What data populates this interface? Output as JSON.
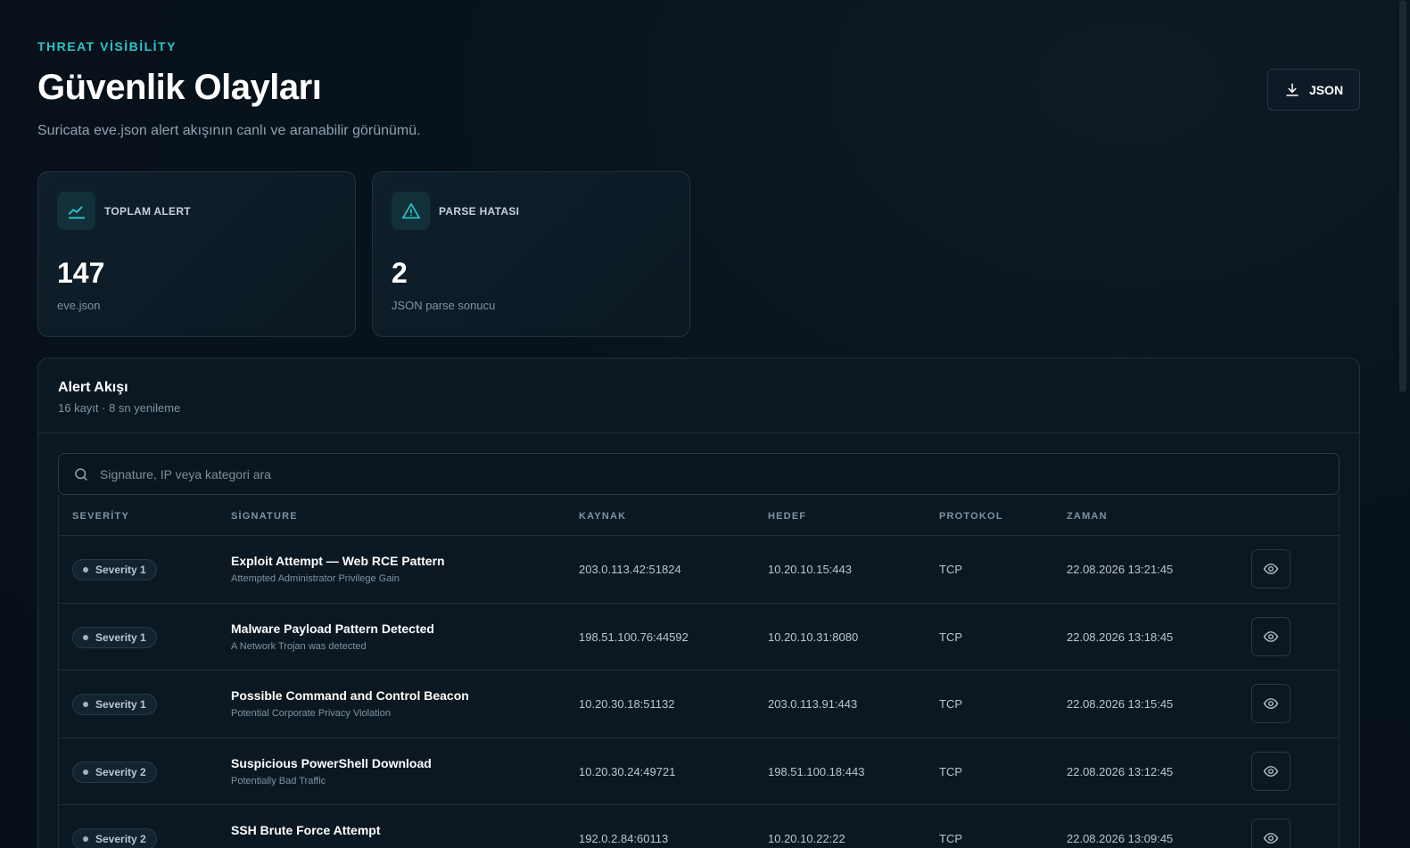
{
  "header": {
    "eyebrow": "THREAT VİSİBİLİTY",
    "title": "Güvenlik Olayları",
    "subtitle": "Suricata eve.json alert akışının canlı ve aranabilir görünümü.",
    "export_label": "JSON"
  },
  "stats": [
    {
      "icon": "trend-line-icon",
      "label": "TOPLAM ALERT",
      "value": "147",
      "caption": "eve.json"
    },
    {
      "icon": "warning-triangle-icon",
      "label": "PARSE HATASI",
      "value": "2",
      "caption": "JSON parse sonucu"
    }
  ],
  "panel": {
    "title": "Alert Akışı",
    "subtitle": "16 kayıt · 8 sn yenileme"
  },
  "search": {
    "placeholder": "Signature, IP veya kategori ara"
  },
  "table": {
    "columns": [
      "SEVERİTY",
      "SİGNATURE",
      "KAYNAK",
      "HEDEF",
      "PROTOKOL",
      "ZAMAN"
    ],
    "rows": [
      {
        "severity": "Severity 1",
        "signature": "Exploit Attempt — Web RCE Pattern",
        "category": "Attempted Administrator Privilege Gain",
        "source": "203.0.113.42:51824",
        "destination": "10.20.10.15:443",
        "protocol": "TCP",
        "time": "22.08.2026 13:21:45"
      },
      {
        "severity": "Severity 1",
        "signature": "Malware Payload Pattern Detected",
        "category": "A Network Trojan was detected",
        "source": "198.51.100.76:44592",
        "destination": "10.20.10.31:8080",
        "protocol": "TCP",
        "time": "22.08.2026 13:18:45"
      },
      {
        "severity": "Severity 1",
        "signature": "Possible Command and Control Beacon",
        "category": "Potential Corporate Privacy Violation",
        "source": "10.20.30.18:51132",
        "destination": "203.0.113.91:443",
        "protocol": "TCP",
        "time": "22.08.2026 13:15:45"
      },
      {
        "severity": "Severity 2",
        "signature": "Suspicious PowerShell Download",
        "category": "Potentially Bad Traffic",
        "source": "10.20.30.24:49721",
        "destination": "198.51.100.18:443",
        "protocol": "TCP",
        "time": "22.08.2026 13:12:45"
      },
      {
        "severity": "Severity 2",
        "signature": "SSH Brute Force Attempt",
        "category": "",
        "source": "192.0.2.84:60113",
        "destination": "10.20.10.22:22",
        "protocol": "TCP",
        "time": "22.08.2026 13:09:45"
      }
    ]
  },
  "colors": {
    "accent": "#2cc7c9",
    "background": "#08121a",
    "card": "#0f1f2b",
    "border": "#1f3141"
  }
}
